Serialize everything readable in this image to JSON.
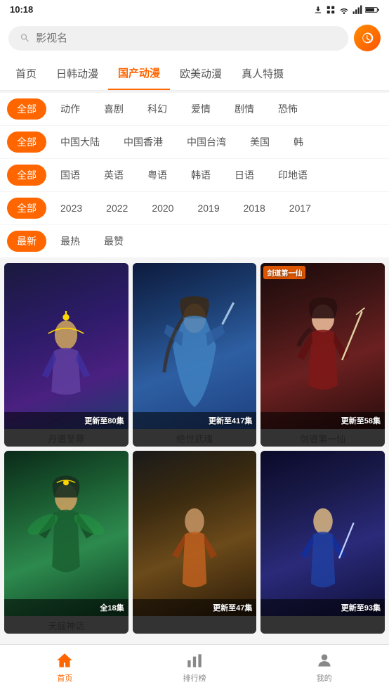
{
  "statusBar": {
    "time": "10:18",
    "icons": [
      "download",
      "app",
      "wifi",
      "signal",
      "battery"
    ]
  },
  "search": {
    "placeholder": "影视名",
    "historyIcon": "history"
  },
  "navTabs": {
    "items": [
      {
        "label": "首页",
        "active": false
      },
      {
        "label": "日韩动漫",
        "active": false
      },
      {
        "label": "国产动漫",
        "active": true
      },
      {
        "label": "欧美动漫",
        "active": false
      },
      {
        "label": "真人特摄",
        "active": false
      }
    ]
  },
  "filters": {
    "genre": {
      "items": [
        "全部",
        "动作",
        "喜剧",
        "科幻",
        "爱情",
        "剧情",
        "恐怖"
      ],
      "active": "全部"
    },
    "region": {
      "items": [
        "全部",
        "中国大陆",
        "中国香港",
        "中国台湾",
        "美国",
        "韩"
      ],
      "active": "全部"
    },
    "language": {
      "items": [
        "全部",
        "国语",
        "英语",
        "粤语",
        "韩语",
        "日语",
        "印地语"
      ],
      "active": "全部"
    },
    "year": {
      "items": [
        "全部",
        "2023",
        "2022",
        "2020",
        "2019",
        "2018",
        "2017"
      ],
      "active": "全部"
    },
    "sort": {
      "items": [
        "最新",
        "最热",
        "最赞"
      ],
      "active": "最新"
    }
  },
  "cards": [
    {
      "id": 1,
      "title": "丹道至尊",
      "badge": "更新至80集",
      "bgClass": "card-bg-1"
    },
    {
      "id": 2,
      "title": "绝世武魂",
      "badge": "更新至417集",
      "bgClass": "card-bg-2"
    },
    {
      "id": 3,
      "title": "剑道第一仙",
      "badge": "更新至58集",
      "badgeTop": "剑道第一仙",
      "bgClass": "card-bg-3"
    },
    {
      "id": 4,
      "title": "天庭神话",
      "badge": "全18集",
      "bgClass": "card-bg-4"
    },
    {
      "id": 5,
      "title": "",
      "badge": "更新至47集",
      "bgClass": "card-bg-5"
    },
    {
      "id": 6,
      "title": "",
      "badge": "更新至93集",
      "bgClass": "card-bg-6"
    }
  ],
  "bottomNav": {
    "items": [
      {
        "label": "首页",
        "icon": "home",
        "active": true
      },
      {
        "label": "排行榜",
        "icon": "chart",
        "active": false
      },
      {
        "label": "我的",
        "icon": "user",
        "active": false
      }
    ]
  }
}
